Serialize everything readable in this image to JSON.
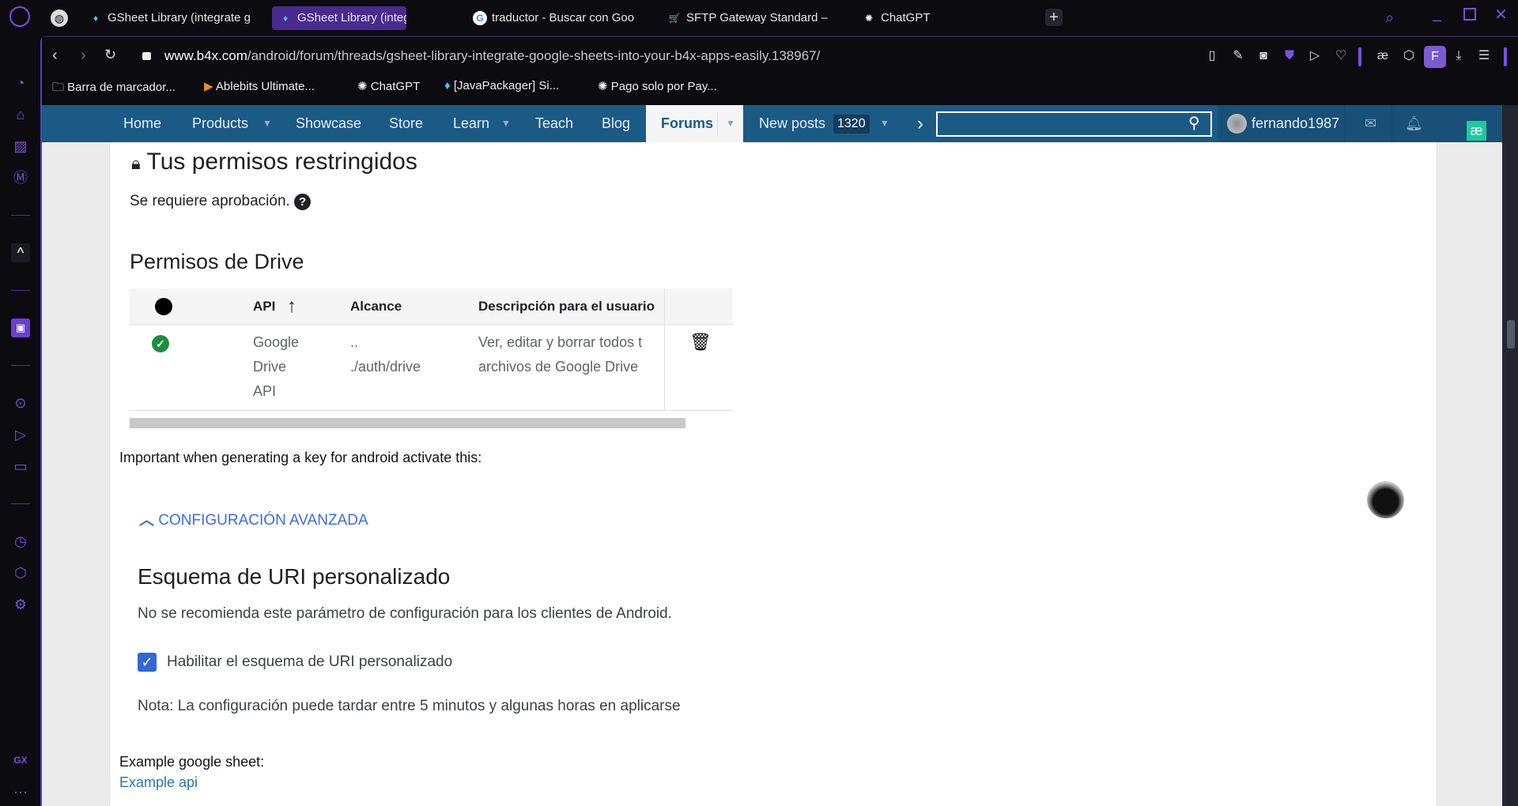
{
  "browser": {
    "tabs": [
      {
        "title": "GSheet Library (integrate g",
        "icon": "b4x-flame-icon",
        "active": false
      },
      {
        "title": "GSheet Library (integrate g",
        "icon": "b4x-flame-icon",
        "active": true
      },
      {
        "title": "traductor - Buscar con Goo",
        "icon": "google-icon",
        "active": false
      },
      {
        "title": "SFTP Gateway Standard –",
        "icon": "cart-icon",
        "active": false
      },
      {
        "title": "ChatGPT",
        "icon": "chatgpt-icon",
        "active": false
      }
    ],
    "url_host": "www.b4x.com",
    "url_path": "/android/forum/threads/gsheet-library-integrate-google-sheets-into-your-b4x-apps-easily.138967/",
    "profile_letter": "F",
    "bookmarks": [
      "Barra de marcador...",
      "Ablebits Ultimate...",
      "ChatGPT",
      "[JavaPackager] Si...",
      "Pago solo por Pay..."
    ],
    "sidebar_label": "GX",
    "accent": "#7a4fe0"
  },
  "nav": {
    "items": [
      "Home",
      "Products",
      "Showcase",
      "Store",
      "Learn",
      "Teach",
      "Blog",
      "Forums",
      "New posts"
    ],
    "new_posts_count": "1320",
    "username": "fernando1987",
    "search_placeholder": "",
    "color": "#1b5a85"
  },
  "post": {
    "restricted_title": "Tus permisos restringidos",
    "approval": "Se requiere aprobación.",
    "drive_title": "Permisos de Drive",
    "table": {
      "headers": [
        "API",
        "Alcance",
        "Descripción para el usuario"
      ],
      "rows": [
        {
          "api": [
            "Google",
            "Drive",
            "API"
          ],
          "scope": [
            "..",
            "./auth/drive"
          ],
          "description": [
            "Ver, editar y borrar todos t",
            "archivos de Google Drive"
          ],
          "status": "ok"
        }
      ]
    },
    "important": "Important when generating a key for android activate this:",
    "advanced": "CONFIGURACIÓN AVANZADA",
    "uri_title": "Esquema de URI personalizado",
    "uri_desc": "No se recomienda este parámetro de configuración para los clientes de Android.",
    "checkbox_label": "Habilitar el esquema de URI personalizado",
    "checkbox_checked": true,
    "note": "Nota: La configuración puede tardar entre 5 minutos y algunas horas en aplicarse",
    "example_label": "Example google sheet:",
    "example_link": "Example api"
  }
}
